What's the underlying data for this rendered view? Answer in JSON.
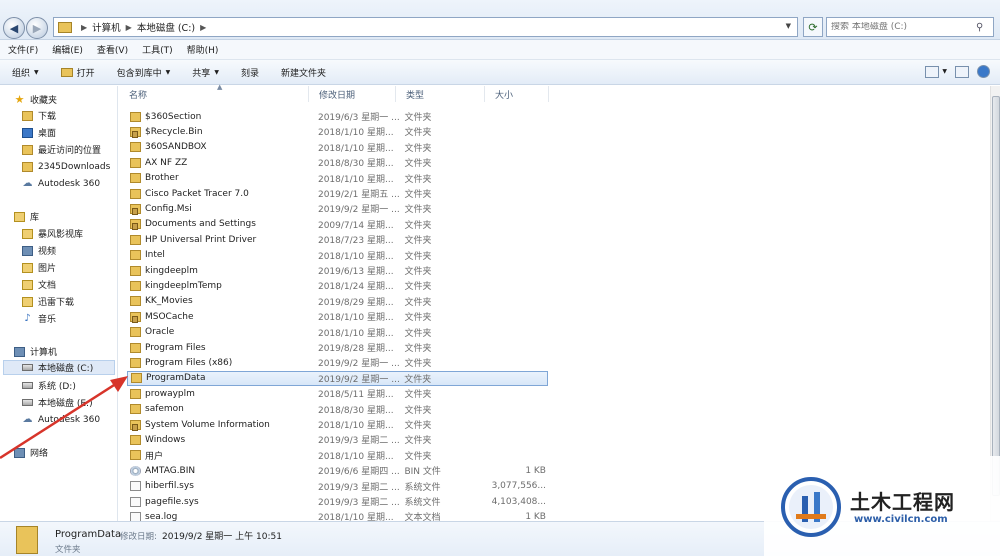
{
  "address": {
    "crumbs": [
      "计算机",
      "本地磁盘 (C:)"
    ],
    "search_placeholder": "搜索 本地磁盘 (C:)"
  },
  "menu": [
    "文件(F)",
    "编辑(E)",
    "查看(V)",
    "工具(T)",
    "帮助(H)"
  ],
  "toolbar": {
    "organize": "组织",
    "open": "打开",
    "include_library": "包含到库中",
    "share": "共享",
    "burn": "刻录",
    "new_folder": "新建文件夹"
  },
  "nav": {
    "favorites": "收藏夹",
    "fav_items": [
      "下载",
      "桌面",
      "最近访问的位置",
      "2345Downloads",
      "Autodesk 360"
    ],
    "libraries": "库",
    "lib_items": [
      "暴风影视库",
      "视频",
      "图片",
      "文档",
      "迅雷下载",
      "音乐"
    ],
    "computer": "计算机",
    "comp_items": [
      "本地磁盘 (C:)",
      "系统 (D:)",
      "本地磁盘 (E:)",
      "Autodesk 360"
    ],
    "network": "网络"
  },
  "columns": {
    "name": "名称",
    "date": "修改日期",
    "type": "类型",
    "size": "大小"
  },
  "files": [
    {
      "name": "$360Section",
      "date": "2019/6/3 星期一 ...",
      "type": "文件夹",
      "size": "",
      "icon": "folder"
    },
    {
      "name": "$Recycle.Bin",
      "date": "2018/1/10 星期...",
      "type": "文件夹",
      "size": "",
      "icon": "lock"
    },
    {
      "name": "360SANDBOX",
      "date": "2018/1/10 星期...",
      "type": "文件夹",
      "size": "",
      "icon": "folder"
    },
    {
      "name": "AX NF ZZ",
      "date": "2018/8/30 星期...",
      "type": "文件夹",
      "size": "",
      "icon": "folder"
    },
    {
      "name": "Brother",
      "date": "2018/1/10 星期...",
      "type": "文件夹",
      "size": "",
      "icon": "folder"
    },
    {
      "name": "Cisco Packet Tracer 7.0",
      "date": "2019/2/1 星期五 ...",
      "type": "文件夹",
      "size": "",
      "icon": "folder"
    },
    {
      "name": "Config.Msi",
      "date": "2019/9/2 星期一 ...",
      "type": "文件夹",
      "size": "",
      "icon": "lock"
    },
    {
      "name": "Documents and Settings",
      "date": "2009/7/14 星期...",
      "type": "文件夹",
      "size": "",
      "icon": "lock"
    },
    {
      "name": "HP Universal Print Driver",
      "date": "2018/7/23 星期...",
      "type": "文件夹",
      "size": "",
      "icon": "folder"
    },
    {
      "name": "Intel",
      "date": "2018/1/10 星期...",
      "type": "文件夹",
      "size": "",
      "icon": "folder"
    },
    {
      "name": "kingdeeplm",
      "date": "2019/6/13 星期...",
      "type": "文件夹",
      "size": "",
      "icon": "folder"
    },
    {
      "name": "kingdeeplmTemp",
      "date": "2018/1/24 星期...",
      "type": "文件夹",
      "size": "",
      "icon": "folder"
    },
    {
      "name": "KK_Movies",
      "date": "2019/8/29 星期...",
      "type": "文件夹",
      "size": "",
      "icon": "folder"
    },
    {
      "name": "MSOCache",
      "date": "2018/1/10 星期...",
      "type": "文件夹",
      "size": "",
      "icon": "lock"
    },
    {
      "name": "Oracle",
      "date": "2018/1/10 星期...",
      "type": "文件夹",
      "size": "",
      "icon": "folder"
    },
    {
      "name": "Program Files",
      "date": "2019/8/28 星期...",
      "type": "文件夹",
      "size": "",
      "icon": "folder"
    },
    {
      "name": "Program Files (x86)",
      "date": "2019/9/2 星期一 ...",
      "type": "文件夹",
      "size": "",
      "icon": "folder"
    },
    {
      "name": "ProgramData",
      "date": "2019/9/2 星期一 ...",
      "type": "文件夹",
      "size": "",
      "icon": "folder",
      "selected": true
    },
    {
      "name": "prowayplm",
      "date": "2018/5/11 星期...",
      "type": "文件夹",
      "size": "",
      "icon": "folder"
    },
    {
      "name": "safemon",
      "date": "2018/8/30 星期...",
      "type": "文件夹",
      "size": "",
      "icon": "folder"
    },
    {
      "name": "System Volume Information",
      "date": "2018/1/10 星期...",
      "type": "文件夹",
      "size": "",
      "icon": "lock"
    },
    {
      "name": "Windows",
      "date": "2019/9/3 星期二 ...",
      "type": "文件夹",
      "size": "",
      "icon": "folder"
    },
    {
      "name": "用户",
      "date": "2018/1/10 星期...",
      "type": "文件夹",
      "size": "",
      "icon": "folder"
    },
    {
      "name": "AMTAG.BIN",
      "date": "2019/6/6 星期四 ...",
      "type": "BIN 文件",
      "size": "1 KB",
      "icon": "disc"
    },
    {
      "name": "hiberfil.sys",
      "date": "2019/9/3 星期二 ...",
      "type": "系统文件",
      "size": "3,077,556...",
      "icon": "file"
    },
    {
      "name": "pagefile.sys",
      "date": "2019/9/3 星期二 ...",
      "type": "系统文件",
      "size": "4,103,408...",
      "icon": "file"
    },
    {
      "name": "sea.log",
      "date": "2018/1/10 星期...",
      "type": "文本文档",
      "size": "1 KB",
      "icon": "file"
    }
  ],
  "details": {
    "name": "ProgramData",
    "modified_label": "修改日期:",
    "modified": "2019/9/2 星期一 上午 10:51",
    "type": "文件夹"
  },
  "watermark": {
    "title": "土木工程网",
    "url": "www.civilcn.com"
  },
  "colors": {
    "selection": "#d8e7f8",
    "folder": "#e9c35a",
    "arrow": "#d7342a"
  }
}
